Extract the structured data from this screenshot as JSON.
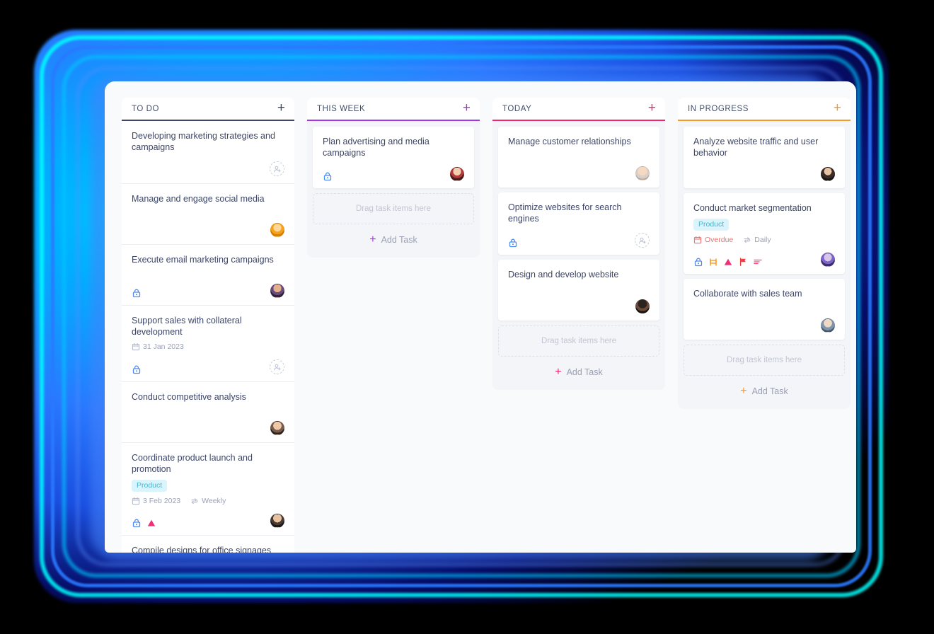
{
  "theme": {
    "panel_bg": "#f9fafc",
    "column_bg": "#f4f5f8",
    "card_bg": "#ffffff",
    "title_color": "#3d4668",
    "muted_color": "#9aa1b4",
    "tag_bg": "#d9f4fb",
    "tag_text": "#4fb3cf",
    "overdue_color": "#f2706e",
    "lock_color": "#4d8bf0",
    "glow_cyan": "#00e5ff",
    "glow_blue": "#2979ff"
  },
  "board": {
    "columns": [
      {
        "id": "todo",
        "title": "TO DO",
        "accent": "#3d4668",
        "plus_label": "+",
        "has_dropzone": false,
        "has_add_task": false,
        "add_task_label": "",
        "dropzone_label": "",
        "cards": [
          {
            "title": "Developing marketing strategies and campaigns",
            "tag": "",
            "date": "",
            "repeat": "",
            "overdue": false,
            "lock": false,
            "icons": [],
            "assignee": "add-person",
            "avatar_class": ""
          },
          {
            "title": "Manage and engage social media",
            "tag": "",
            "date": "",
            "repeat": "",
            "overdue": false,
            "lock": false,
            "icons": [],
            "assignee": "avatar",
            "avatar_class": "a2"
          },
          {
            "title": "Execute email marketing campaigns",
            "tag": "",
            "date": "",
            "repeat": "",
            "overdue": false,
            "lock": true,
            "icons": [
              "lock"
            ],
            "assignee": "avatar",
            "avatar_class": "a3"
          },
          {
            "title": "Support sales with collateral development",
            "tag": "",
            "date": "31 Jan 2023",
            "repeat": "",
            "overdue": false,
            "lock": true,
            "icons": [
              "lock"
            ],
            "assignee": "add-person",
            "avatar_class": ""
          },
          {
            "title": "Conduct competitive analysis",
            "tag": "",
            "date": "",
            "repeat": "",
            "overdue": false,
            "lock": false,
            "icons": [],
            "assignee": "avatar",
            "avatar_class": "a4"
          },
          {
            "title": "Coordinate product launch and promotion",
            "tag": "Product",
            "date": "3 Feb 2023",
            "repeat": "Weekly",
            "overdue": false,
            "lock": true,
            "icons": [
              "lock",
              "priority-triangle"
            ],
            "assignee": "avatar",
            "avatar_class": "a5"
          },
          {
            "title": "Compile designs for office signages",
            "tag": "",
            "date": "",
            "repeat": "",
            "overdue": false,
            "lock": false,
            "icons": [],
            "assignee": "",
            "avatar_class": ""
          }
        ]
      },
      {
        "id": "this-week",
        "title": "THIS WEEK",
        "accent": "#a734e8",
        "plus_label": "+",
        "has_dropzone": true,
        "has_add_task": true,
        "add_task_label": "Add Task",
        "dropzone_label": "Drag task items here",
        "cards": [
          {
            "title": "Plan advertising and media campaigns",
            "tag": "",
            "date": "",
            "repeat": "",
            "overdue": false,
            "lock": true,
            "icons": [
              "lock"
            ],
            "assignee": "avatar",
            "avatar_class": "a6"
          }
        ]
      },
      {
        "id": "today",
        "title": "TODAY",
        "accent": "#f0256f",
        "plus_label": "+",
        "has_dropzone": true,
        "has_add_task": true,
        "add_task_label": "Add Task",
        "dropzone_label": "Drag task items here",
        "cards": [
          {
            "title": "Manage customer relationships",
            "tag": "",
            "date": "",
            "repeat": "",
            "overdue": false,
            "lock": false,
            "icons": [],
            "assignee": "avatar",
            "avatar_class": "a7"
          },
          {
            "title": "Optimize websites for search engines",
            "tag": "",
            "date": "",
            "repeat": "",
            "overdue": false,
            "lock": true,
            "icons": [
              "lock"
            ],
            "assignee": "add-person",
            "avatar_class": ""
          },
          {
            "title": "Design and develop website",
            "tag": "",
            "date": "",
            "repeat": "",
            "overdue": false,
            "lock": false,
            "icons": [],
            "assignee": "avatar",
            "avatar_class": "a8"
          }
        ]
      },
      {
        "id": "in-progress",
        "title": "IN PROGRESS",
        "accent": "#f59a23",
        "plus_label": "+",
        "has_dropzone": true,
        "has_add_task": true,
        "add_task_label": "Add Task",
        "dropzone_label": "Drag task items here",
        "cards": [
          {
            "title": "Analyze website traffic and user behavior",
            "tag": "",
            "date": "",
            "repeat": "",
            "overdue": false,
            "lock": false,
            "icons": [],
            "assignee": "avatar",
            "avatar_class": "a9"
          },
          {
            "title": "Conduct market segmentation",
            "tag": "Product",
            "date": "Overdue",
            "repeat": "Daily",
            "overdue": true,
            "lock": true,
            "icons": [
              "lock",
              "milestone",
              "priority-triangle",
              "flag",
              "description"
            ],
            "assignee": "avatar",
            "avatar_class": "a10"
          },
          {
            "title": "Collaborate with sales team",
            "tag": "",
            "date": "",
            "repeat": "",
            "overdue": false,
            "lock": false,
            "icons": [],
            "assignee": "avatar",
            "avatar_class": "a11"
          }
        ]
      }
    ]
  }
}
